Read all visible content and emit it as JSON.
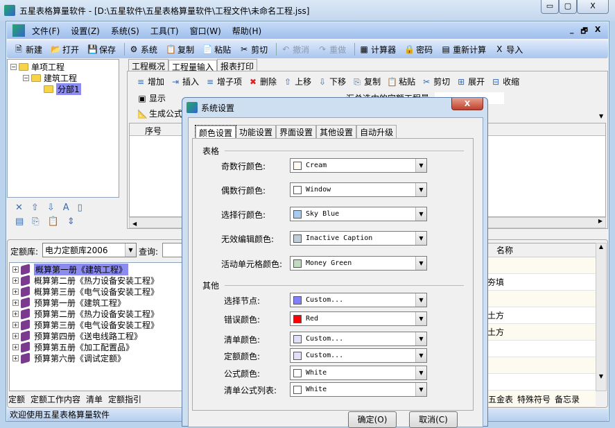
{
  "window": {
    "title": "五星表格算量软件 - [D:\\五星软件\\五星表格算量软件\\工程文件\\未命名工程.jss]",
    "min": "▭",
    "max": "▢",
    "close": "X"
  },
  "menu": [
    "文件(F)",
    "设置(Z)",
    "系统(S)",
    "工具(T)",
    "窗口(W)",
    "帮助(H)"
  ],
  "mdi_controls": {
    "min": "_",
    "restore": "🗗",
    "close": "X"
  },
  "toolbar": [
    {
      "icon": "new-icon",
      "glyph": "🗎",
      "label": "新建"
    },
    {
      "icon": "open-icon",
      "glyph": "📂",
      "label": "打开"
    },
    {
      "icon": "save-icon",
      "glyph": "💾",
      "label": "保存"
    },
    {
      "icon": "system-icon",
      "glyph": "⚙",
      "label": "系统"
    },
    {
      "icon": "copy-icon",
      "glyph": "📋",
      "label": "复制"
    },
    {
      "icon": "paste-icon",
      "glyph": "📄",
      "label": "粘贴"
    },
    {
      "icon": "cut-icon",
      "glyph": "✂",
      "label": "剪切"
    },
    {
      "icon": "undo-icon",
      "glyph": "↶",
      "label": "撤消",
      "disabled": true
    },
    {
      "icon": "redo-icon",
      "glyph": "↷",
      "label": "重做",
      "disabled": true
    },
    {
      "icon": "calculator-icon",
      "glyph": "▦",
      "label": "计算器"
    },
    {
      "icon": "lock-icon",
      "glyph": "🔒",
      "label": "密码"
    },
    {
      "icon": "recalc-icon",
      "glyph": "▤",
      "label": "重新计算"
    },
    {
      "icon": "import-icon",
      "glyph": "X",
      "label": "导入"
    }
  ],
  "project_tree": [
    {
      "label": "单项工程",
      "level": 0
    },
    {
      "label": "建筑工程",
      "level": 1
    },
    {
      "label": "分部1",
      "level": 2,
      "selected": true
    }
  ],
  "main_tabs": [
    "工程概况",
    "工程量输入",
    "报表打印"
  ],
  "main_tab_active": 1,
  "edit_toolbar": [
    {
      "icon": "add-icon",
      "glyph": "≡",
      "label": "增加"
    },
    {
      "icon": "insert-icon",
      "glyph": "⇥",
      "label": "插入"
    },
    {
      "icon": "add-child-icon",
      "glyph": "≡",
      "label": "增子项"
    },
    {
      "icon": "delete-icon",
      "glyph": "✖",
      "label": "删除"
    },
    {
      "icon": "move-up-icon",
      "glyph": "⇧",
      "label": "上移"
    },
    {
      "icon": "move-down-icon",
      "glyph": "⇩",
      "label": "下移"
    },
    {
      "icon": "copy-icon",
      "glyph": "⎘",
      "label": "复制"
    },
    {
      "icon": "paste-icon",
      "glyph": "📋",
      "label": "粘贴"
    },
    {
      "icon": "cut-icon",
      "glyph": "✂",
      "label": "剪切"
    },
    {
      "icon": "expand-icon",
      "glyph": "⊞",
      "label": "展开"
    },
    {
      "icon": "collapse-icon",
      "glyph": "⊟",
      "label": "收缩"
    }
  ],
  "edit_toolbar2": {
    "show": "显示",
    "gen_formula": "生成公式",
    "partial": "汇总选中的定额工程量"
  },
  "grid": {
    "col_seq": "序号"
  },
  "quota": {
    "lib_label": "定额库:",
    "lib_value": "电力定额库2006",
    "query_label": "查询:"
  },
  "quota_tree": [
    {
      "label": "概算第一册《建筑工程》",
      "selected": true
    },
    {
      "label": "概算第二册《热力设备安装工程》"
    },
    {
      "label": "概算第三册《电气设备安装工程》"
    },
    {
      "label": "预算第一册《建筑工程》"
    },
    {
      "label": "预算第二册《热力设备安装工程》"
    },
    {
      "label": "预算第三册《电气设备安装工程》"
    },
    {
      "label": "预算第四册《送电线路工程》"
    },
    {
      "label": "预算第五册《加工配置品》"
    },
    {
      "label": "预算第六册《调试定额》"
    }
  ],
  "bottom_tabs": [
    "定额",
    "定额工作内容",
    "清单",
    "定额指引"
  ],
  "right_bottom_tabs": [
    "五金表",
    "特殊符号",
    "备忘录"
  ],
  "right_grid": {
    "header": "名称",
    "rows": [
      "",
      "夯填",
      "",
      "土方",
      "土方",
      "",
      "",
      "",
      ""
    ]
  },
  "status": "欢迎使用五星表格算量软件",
  "dialog": {
    "title": "系统设置",
    "close": "X",
    "tabs": [
      "颜色设置",
      "功能设置",
      "界面设置",
      "其他设置",
      "自动升级"
    ],
    "active_tab": 0,
    "group_table": "表格",
    "group_other": "其他",
    "table_rows": [
      {
        "label": "奇数行颜色:",
        "value": "Cream",
        "color": "#fffbf0"
      },
      {
        "label": "偶数行颜色:",
        "value": "Window",
        "color": "#ffffff"
      },
      {
        "label": "选择行颜色:",
        "value": "Sky Blue",
        "color": "#a6caf0"
      },
      {
        "label": "无效编辑颜色:",
        "value": "Inactive Caption",
        "color": "#bfcddb"
      },
      {
        "label": "活动单元格颜色:",
        "value": "Money Green",
        "color": "#c0dcc0"
      }
    ],
    "other_rows": [
      {
        "label": "选择节点:",
        "value": "Custom...",
        "color": "#8080ff"
      },
      {
        "label": "错误颜色:",
        "value": "Red",
        "color": "#ff0000"
      },
      {
        "label": "清单颜色:",
        "value": "Custom...",
        "color": "#e0e0f8"
      },
      {
        "label": "定额颜色:",
        "value": "Custom...",
        "color": "#e0e0f8"
      },
      {
        "label": "公式颜色:",
        "value": "White",
        "color": "#ffffff"
      },
      {
        "label": "清单公式列表:",
        "value": "White",
        "color": "#ffffff"
      }
    ],
    "ok": "确定(O)",
    "cancel": "取消(C)"
  }
}
